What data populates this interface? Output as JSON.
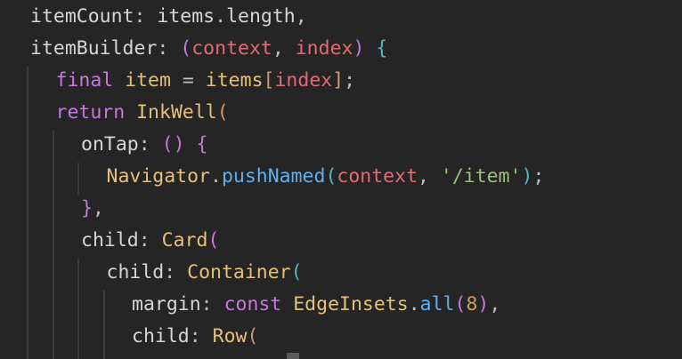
{
  "editor": {
    "language": "dart",
    "colors": {
      "background": "#252526",
      "property": "#d6d6d6",
      "parameter": "#e06c75",
      "keyword": "#c678dd",
      "class": "#e5c07b",
      "function": "#61afef",
      "string": "#98c379",
      "number": "#d19a66"
    },
    "lines": [
      {
        "indent": 0,
        "tokens": [
          {
            "text": "itemCount",
            "type": "prop"
          },
          {
            "text": ": ",
            "type": "punct"
          },
          {
            "text": "items",
            "type": "plain"
          },
          {
            "text": ".",
            "type": "punct"
          },
          {
            "text": "length",
            "type": "plain"
          },
          {
            "text": ",",
            "type": "punct"
          }
        ]
      },
      {
        "indent": 0,
        "tokens": [
          {
            "text": "itemBuilder",
            "type": "prop"
          },
          {
            "text": ": ",
            "type": "punct"
          },
          {
            "text": "(",
            "type": "paren1"
          },
          {
            "text": "context",
            "type": "param"
          },
          {
            "text": ", ",
            "type": "punct"
          },
          {
            "text": "index",
            "type": "param"
          },
          {
            "text": ") ",
            "type": "paren1"
          },
          {
            "text": "{",
            "type": "paren2"
          }
        ]
      },
      {
        "indent": 1,
        "tokens": [
          {
            "text": "final ",
            "type": "kw"
          },
          {
            "text": "item",
            "type": "class"
          },
          {
            "text": " = ",
            "type": "punct"
          },
          {
            "text": "items",
            "type": "class"
          },
          {
            "text": "[",
            "type": "bracket"
          },
          {
            "text": "index",
            "type": "param"
          },
          {
            "text": "]",
            "type": "bracket"
          },
          {
            "text": ";",
            "type": "punct"
          }
        ]
      },
      {
        "indent": 1,
        "tokens": [
          {
            "text": "return ",
            "type": "kw"
          },
          {
            "text": "InkWell",
            "type": "class"
          },
          {
            "text": "(",
            "type": "bracket"
          }
        ]
      },
      {
        "indent": 2,
        "tokens": [
          {
            "text": "onTap",
            "type": "prop"
          },
          {
            "text": ": ",
            "type": "punct"
          },
          {
            "text": "() ",
            "type": "paren1"
          },
          {
            "text": "{",
            "type": "paren1"
          }
        ]
      },
      {
        "indent": 3,
        "tokens": [
          {
            "text": "Navigator",
            "type": "class"
          },
          {
            "text": ".",
            "type": "punct"
          },
          {
            "text": "pushNamed",
            "type": "fn"
          },
          {
            "text": "(",
            "type": "paren2"
          },
          {
            "text": "context",
            "type": "param"
          },
          {
            "text": ", ",
            "type": "punct"
          },
          {
            "text": "'/item'",
            "type": "str"
          },
          {
            "text": ")",
            "type": "paren2"
          },
          {
            "text": ";",
            "type": "punct"
          }
        ]
      },
      {
        "indent": 2,
        "tokens": [
          {
            "text": "}",
            "type": "paren1"
          },
          {
            "text": ",",
            "type": "punct"
          }
        ]
      },
      {
        "indent": 2,
        "tokens": [
          {
            "text": "child",
            "type": "prop"
          },
          {
            "text": ": ",
            "type": "punct"
          },
          {
            "text": "Card",
            "type": "class"
          },
          {
            "text": "(",
            "type": "paren1"
          }
        ]
      },
      {
        "indent": 3,
        "tokens": [
          {
            "text": "child",
            "type": "prop"
          },
          {
            "text": ": ",
            "type": "punct"
          },
          {
            "text": "Container",
            "type": "class"
          },
          {
            "text": "(",
            "type": "paren2"
          }
        ]
      },
      {
        "indent": 4,
        "tokens": [
          {
            "text": "margin",
            "type": "prop"
          },
          {
            "text": ": ",
            "type": "punct"
          },
          {
            "text": "const ",
            "type": "kw"
          },
          {
            "text": "EdgeInsets",
            "type": "class"
          },
          {
            "text": ".",
            "type": "punct"
          },
          {
            "text": "all",
            "type": "fn"
          },
          {
            "text": "(",
            "type": "paren1"
          },
          {
            "text": "8",
            "type": "num"
          },
          {
            "text": ")",
            "type": "paren1"
          },
          {
            "text": ",",
            "type": "punct"
          }
        ]
      },
      {
        "indent": 4,
        "tokens": [
          {
            "text": "child",
            "type": "prop"
          },
          {
            "text": ": ",
            "type": "punct"
          },
          {
            "text": "Row",
            "type": "class"
          },
          {
            "text": "(",
            "type": "bracket"
          }
        ]
      }
    ]
  }
}
